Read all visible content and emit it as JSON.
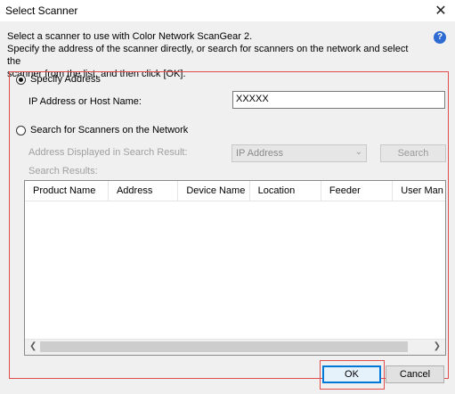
{
  "window": {
    "title": "Select Scanner",
    "close_glyph": "✕"
  },
  "instructions": "Select a scanner to use with Color Network ScanGear 2.\nSpecify the address of the scanner directly, or search for scanners on the network and select the scanner from the list, and then click [OK].",
  "instructions_lines": [
    "Select a scanner to use with Color Network ScanGear 2.",
    "Specify the address of the scanner directly, or search for scanners on the network and select the",
    "scanner from the list, and then click [OK]."
  ],
  "help_icon": "?",
  "specify_address": {
    "label": "Specify Address",
    "selected": true,
    "ip_label": "IP Address or Host Name:",
    "ip_value": "XXXXX"
  },
  "search_network": {
    "label": "Search for Scanners on the Network",
    "selected": false,
    "address_label": "Address Displayed in Search Result:",
    "address_option": "IP Address",
    "search_button": "Search",
    "results_label": "Search Results:"
  },
  "results_table": {
    "columns": [
      "Product Name",
      "Address",
      "Device Name",
      "Location",
      "Feeder",
      "User Man"
    ]
  },
  "buttons": {
    "ok": "OK",
    "cancel": "Cancel"
  },
  "colors": {
    "highlight": "#e04b4b",
    "help_blue": "#2d6bd3",
    "default_button_border": "#0078d7"
  }
}
